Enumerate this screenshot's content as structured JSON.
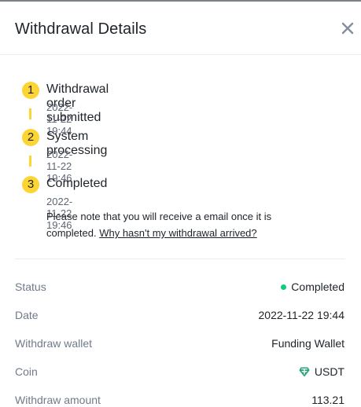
{
  "header": {
    "title": "Withdrawal Details",
    "close_icon": "close-icon"
  },
  "steps": [
    {
      "number": "1",
      "title": "Withdrawal order submitted",
      "time": "2022-11-22 19:44"
    },
    {
      "number": "2",
      "title": "System processing",
      "time": "2022-11-22 19:46"
    },
    {
      "number": "3",
      "title": "Completed",
      "time": "2022-11-22 19:46"
    }
  ],
  "note": {
    "text": "Please note that you will receive a email once it is completed. ",
    "link": "Why hasn't my withdrawal arrived?"
  },
  "details": [
    {
      "label": "Status",
      "value": "Completed"
    },
    {
      "label": "Date",
      "value": "2022-11-22 19:44"
    },
    {
      "label": "Withdraw wallet",
      "value": "Funding Wallet"
    },
    {
      "label": "Coin",
      "value": "USDT",
      "icon": "tether-icon"
    },
    {
      "label": "Withdraw amount",
      "value": "113.21"
    }
  ],
  "colors": {
    "accent": "#fcd535",
    "success": "#0ecb81",
    "tether": "#26a17b"
  }
}
